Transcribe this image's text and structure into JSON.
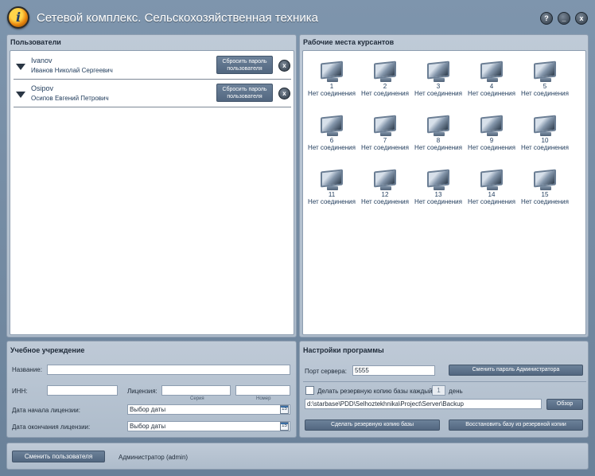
{
  "app": {
    "title": "Сетевой комплекс. Сельскохозяйственная техника",
    "help": "?",
    "minimize": "_",
    "close": "x"
  },
  "users_panel": {
    "title": "Пользователи",
    "reset_label": "Сбросить пароль пользователя",
    "delete_label": "x",
    "users": [
      {
        "login": "Ivanov",
        "fullname": "Иванов  Николай Сергеевич"
      },
      {
        "login": "Osipov",
        "fullname": "Осипов Евгений Петрович"
      }
    ]
  },
  "workstations_panel": {
    "title": "Рабочие места курсантов",
    "status": "Нет соединения",
    "stations": [
      "1",
      "2",
      "3",
      "4",
      "5",
      "6",
      "7",
      "8",
      "9",
      "10",
      "11",
      "12",
      "13",
      "14",
      "15"
    ]
  },
  "school_panel": {
    "title": "Учебное учреждение",
    "name_label": "Название:",
    "name_value": "",
    "inn_label": "ИНН:",
    "inn_value": "",
    "license_label": "Лицензия:",
    "series_label": "Серия",
    "number_label": "Номер",
    "license_start_label": "Дата начала лицензии:",
    "license_end_label": "Дата окончания лицензии:",
    "date_placeholder": "Выбор даты",
    "calendar_day": "15"
  },
  "settings_panel": {
    "title": "Настройки программы",
    "port_label": "Порт сервера:",
    "port_value": "5555",
    "change_admin_pw": "Сменить пароль Администратора",
    "backup_label": "Делать резервную копию базы каждый",
    "backup_days": "1",
    "backup_unit": "день",
    "backup_path": "d:\\starbase\\PDD\\Selhoztekhnika\\Project\\Server\\Backup",
    "browse": "Обзор",
    "make_backup": "Сделать резервную копию базы",
    "restore_backup": "Восстановить базу из резервной копии"
  },
  "footer": {
    "switch_user": "Сменить пользователя",
    "current_user": "Администратор  (admin)"
  }
}
